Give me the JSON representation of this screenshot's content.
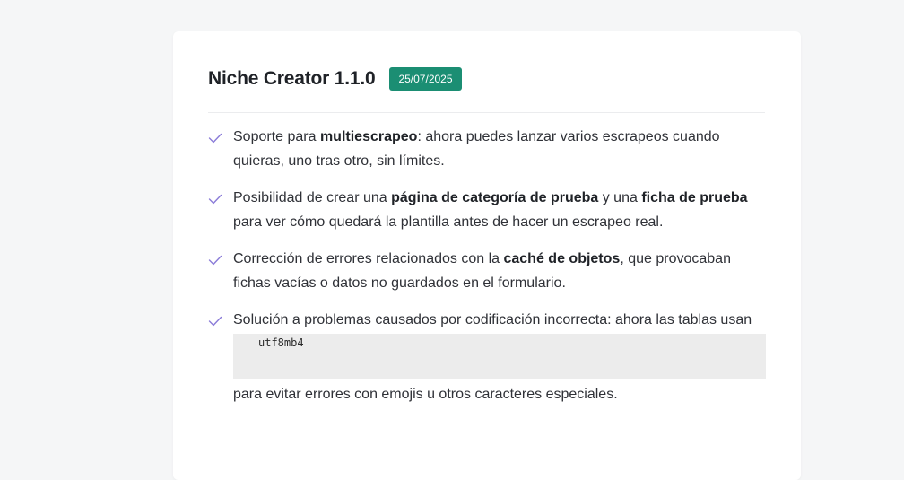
{
  "release": {
    "title": "Niche Creator 1.1.0",
    "date": "25/07/2025"
  },
  "colors": {
    "badge": "#1b8e73",
    "check": "#8a7bd8"
  },
  "items": [
    {
      "icon": "check-icon",
      "t1": "Soporte para ",
      "b1": "multiescrapeo",
      "t2": ": ahora puedes lanzar varios escrapeos cuando quieras, uno tras otro, sin límites."
    },
    {
      "icon": "check-icon",
      "t1": "Posibilidad de crear una ",
      "b1": "página de categoría de prueba",
      "t2": " y una ",
      "b2": "ficha de prueba",
      "t3": " para ver cómo quedará la plantilla antes de hacer un escrapeo real."
    },
    {
      "icon": "check-icon",
      "t1": "Corrección de errores relacionados con la ",
      "b1": "caché de objetos",
      "t2": ", que provocaban fichas vacías o datos no guardados en el formulario."
    },
    {
      "icon": "check-icon",
      "t1": "Solución a problemas causados por codificación incorrecta: ahora las tablas usan",
      "code": "utf8mb4",
      "t2": "para evitar errores con emojis u otros caracteres especiales."
    }
  ]
}
